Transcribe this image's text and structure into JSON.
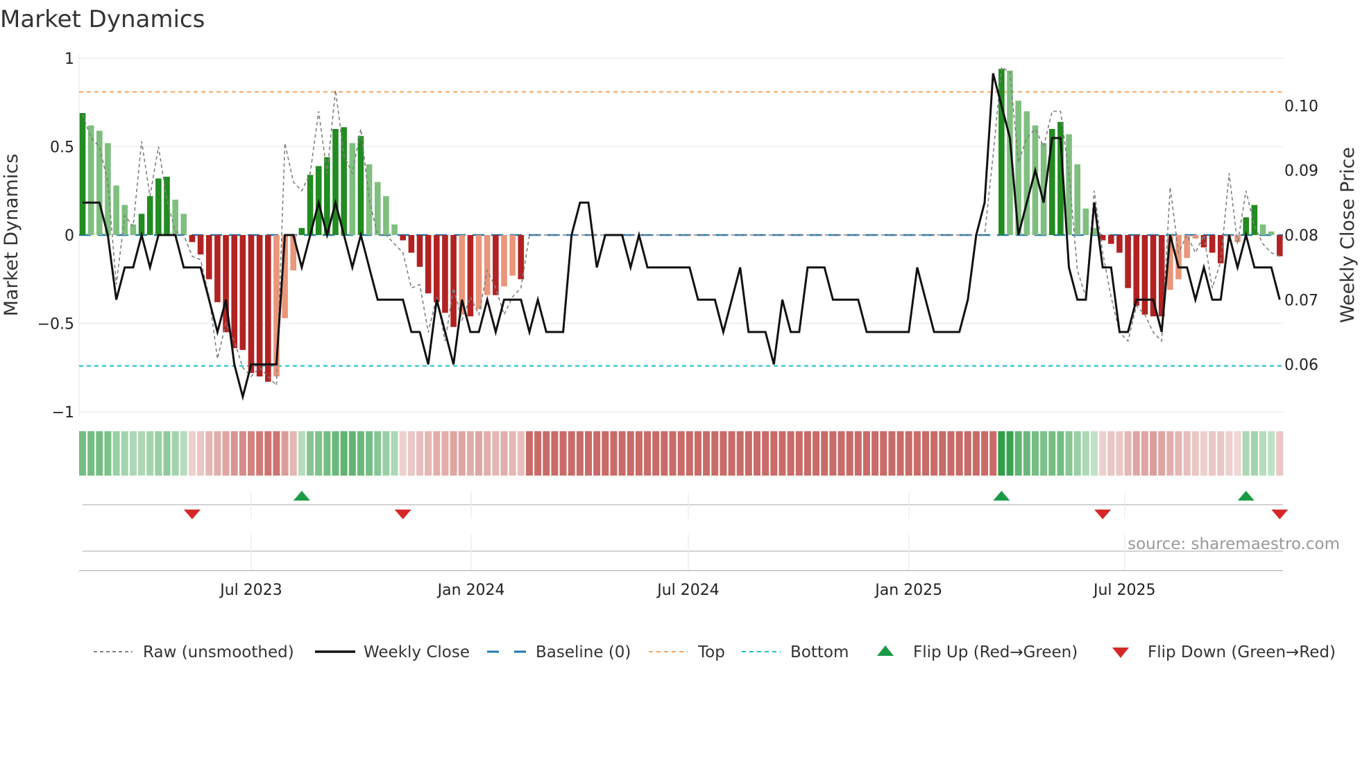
{
  "title": "Market Dynamics",
  "source": "source: sharemaestro.com",
  "colors": {
    "bar_up_strong": "#228B22",
    "bar_up_weak": "#7FBF7F",
    "bar_down_strong": "#B22222",
    "bar_down_weak": "#E9967A",
    "close": "#111111",
    "raw": "#808080",
    "baseline": "#1f77b4",
    "top": "#f4a460",
    "bottom": "#17becf",
    "flip_up": "#1a9a45",
    "flip_down": "#d62728",
    "band_green": "#22963a",
    "band_red": "#b83c37"
  },
  "legend": [
    {
      "key": "raw",
      "label": "Raw (unsmoothed)"
    },
    {
      "key": "close",
      "label": "Weekly Close"
    },
    {
      "key": "baseline",
      "label": "Baseline (0)"
    },
    {
      "key": "top",
      "label": "Top"
    },
    {
      "key": "bottom",
      "label": "Bottom"
    },
    {
      "key": "flip_up",
      "label": "Flip Up (Red→Green)"
    },
    {
      "key": "flip_down",
      "label": "Flip Down (Green→Red)"
    }
  ],
  "chart_data": {
    "type": "bar",
    "title": "Market Dynamics",
    "ylabel": "Market Dynamics",
    "y2label": "Weekly Close Price",
    "xunit": "week",
    "ylim": [
      -1,
      1
    ],
    "y2lim": [
      0.0528,
      0.1077
    ],
    "yticks": [
      {
        "v": 1,
        "label": "1"
      },
      {
        "v": 0.5,
        "label": "0.5"
      },
      {
        "v": 0,
        "label": "0"
      },
      {
        "v": -0.5,
        "label": "−0.5"
      },
      {
        "v": -1,
        "label": "−1"
      }
    ],
    "y2ticks": [
      {
        "v": 0.1,
        "label": "0.10"
      },
      {
        "v": 0.09,
        "label": "0.09"
      },
      {
        "v": 0.08,
        "label": "0.08"
      },
      {
        "v": 0.07,
        "label": "0.07"
      },
      {
        "v": 0.06,
        "label": "0.06"
      }
    ],
    "xticks": [
      {
        "week": 20,
        "label": "Jul 2023"
      },
      {
        "week": 46.1,
        "label": "Jan 2024"
      },
      {
        "week": 71.85,
        "label": "Jul 2024"
      },
      {
        "week": 98,
        "label": "Jan 2025"
      },
      {
        "week": 123.6,
        "label": "Jul 2025"
      }
    ],
    "top_level": 0.81,
    "bottom_level": -0.74,
    "baseline": 0,
    "momentum": [
      0.69,
      0.62,
      0.59,
      0.52,
      0.28,
      0.17,
      0.06,
      0.12,
      0.22,
      0.32,
      0.33,
      0.2,
      0.12,
      -0.04,
      -0.11,
      -0.25,
      -0.38,
      -0.55,
      -0.64,
      -0.65,
      -0.78,
      -0.8,
      -0.83,
      -0.8,
      -0.47,
      -0.2,
      0.04,
      0.34,
      0.39,
      0.44,
      0.6,
      0.61,
      0.52,
      0.56,
      0.4,
      0.3,
      0.22,
      0.06,
      -0.03,
      -0.1,
      -0.18,
      -0.33,
      -0.38,
      -0.44,
      -0.52,
      -0.45,
      -0.46,
      -0.42,
      -0.34,
      -0.34,
      -0.29,
      -0.23,
      -0.25,
      0,
      0,
      0,
      0,
      0,
      0,
      0,
      0,
      0,
      0,
      0,
      0,
      0,
      0,
      0,
      0,
      0,
      0,
      0,
      0,
      0,
      0,
      0,
      0,
      0,
      0,
      0,
      0,
      0,
      0,
      0,
      0,
      0,
      0,
      0,
      0,
      0,
      0,
      0,
      0,
      0,
      0,
      0,
      0,
      0,
      0,
      0,
      0,
      0,
      0,
      0,
      0,
      0,
      0,
      0,
      0,
      0.94,
      0.93,
      0.76,
      0.7,
      0.62,
      0.52,
      0.6,
      0.64,
      0.57,
      0.4,
      0.15,
      0.04,
      -0.03,
      -0.05,
      -0.1,
      -0.3,
      -0.4,
      -0.45,
      -0.46,
      -0.46,
      -0.31,
      -0.25,
      -0.13,
      -0.02,
      -0.07,
      -0.1,
      -0.16,
      -0.01,
      -0.04,
      0.1,
      0.17,
      0.06,
      0.02,
      -0.12
    ],
    "momentum_shade": "DLLLLLLDDDDLLDDDDDDDDDDLLLDDDDDDLDLLLLDDDDDDDLDLLDLLDDLLLLLDDLLLLDDDDDDDDLLLLDDDLLDDLLD",
    "raw": [
      0.68,
      0.55,
      0.5,
      0.3,
      -0.28,
      0.11,
      0.05,
      0.53,
      0.22,
      0.5,
      0.2,
      0.02,
      0.0,
      -0.12,
      -0.14,
      -0.35,
      -0.7,
      -0.5,
      -0.6,
      -0.75,
      -0.8,
      -0.75,
      -0.8,
      -0.85,
      0.52,
      0.3,
      0.25,
      0.35,
      0.7,
      0.35,
      0.82,
      0.45,
      0.35,
      0.6,
      0.2,
      0.0,
      0.0,
      -0.05,
      -0.1,
      -0.3,
      -0.28,
      -0.55,
      -0.35,
      -0.6,
      -0.3,
      -0.48,
      -0.35,
      -0.45,
      -0.2,
      -0.3,
      -0.45,
      -0.35,
      -0.3,
      0,
      0,
      0,
      0,
      0,
      0,
      0,
      0,
      0,
      0,
      0,
      0,
      0,
      0,
      0,
      0,
      0,
      0,
      0,
      0,
      0,
      0,
      0,
      0,
      0,
      0,
      0,
      0,
      0,
      0,
      0,
      0,
      0,
      0,
      0,
      0,
      0,
      0,
      0,
      0,
      0,
      0,
      0,
      0,
      0,
      0,
      0,
      0,
      0,
      0,
      0,
      0,
      0,
      0,
      0,
      0.45,
      0.95,
      0.92,
      0.41,
      0.55,
      0.6,
      0.5,
      0.7,
      0.7,
      0.35,
      -0.2,
      -0.35,
      0.25,
      -0.1,
      -0.35,
      -0.55,
      -0.6,
      -0.4,
      -0.45,
      -0.55,
      -0.6,
      0.27,
      -0.1,
      0,
      -0.1,
      0,
      -0.3,
      -0.15,
      0.35,
      -0.05,
      0.25,
      0.05,
      -0.05,
      -0.1,
      -0.12
    ],
    "close": [
      0.085,
      0.085,
      0.085,
      0.08,
      0.07,
      0.075,
      0.075,
      0.08,
      0.075,
      0.08,
      0.08,
      0.08,
      0.075,
      0.075,
      0.075,
      0.07,
      0.065,
      0.07,
      0.06,
      0.055,
      0.06,
      0.06,
      0.06,
      0.06,
      0.08,
      0.08,
      0.075,
      0.08,
      0.085,
      0.08,
      0.085,
      0.08,
      0.075,
      0.08,
      0.075,
      0.07,
      0.07,
      0.07,
      0.07,
      0.065,
      0.065,
      0.06,
      0.07,
      0.065,
      0.06,
      0.07,
      0.065,
      0.065,
      0.07,
      0.065,
      0.07,
      0.07,
      0.07,
      0.065,
      0.07,
      0.065,
      0.065,
      0.065,
      0.08,
      0.085,
      0.085,
      0.075,
      0.08,
      0.08,
      0.08,
      0.075,
      0.08,
      0.075,
      0.075,
      0.075,
      0.075,
      0.075,
      0.075,
      0.07,
      0.07,
      0.07,
      0.065,
      0.07,
      0.075,
      0.065,
      0.065,
      0.065,
      0.06,
      0.07,
      0.065,
      0.065,
      0.075,
      0.075,
      0.075,
      0.07,
      0.07,
      0.07,
      0.07,
      0.065,
      0.065,
      0.065,
      0.065,
      0.065,
      0.065,
      0.075,
      0.07,
      0.065,
      0.065,
      0.065,
      0.065,
      0.07,
      0.08,
      0.085,
      0.105,
      0.1,
      0.095,
      0.08,
      0.085,
      0.09,
      0.085,
      0.095,
      0.095,
      0.075,
      0.07,
      0.07,
      0.085,
      0.075,
      0.075,
      0.065,
      0.065,
      0.07,
      0.07,
      0.07,
      0.065,
      0.08,
      0.075,
      0.075,
      0.07,
      0.075,
      0.07,
      0.07,
      0.08,
      0.075,
      0.08,
      0.075,
      0.075,
      0.075,
      0.07
    ],
    "regime": [
      0.6,
      0.6,
      0.6,
      0.55,
      0.4,
      0.35,
      0.3,
      0.3,
      0.35,
      0.4,
      0.45,
      0.35,
      0.25,
      -0.15,
      -0.2,
      -0.3,
      -0.35,
      -0.4,
      -0.5,
      -0.55,
      -0.6,
      -0.65,
      -0.7,
      -0.7,
      -0.45,
      -0.3,
      0.25,
      0.5,
      0.55,
      0.6,
      0.65,
      0.7,
      0.7,
      0.65,
      0.6,
      0.5,
      0.4,
      0.3,
      -0.15,
      -0.2,
      -0.25,
      -0.3,
      -0.35,
      -0.35,
      -0.4,
      -0.4,
      -0.35,
      -0.4,
      -0.35,
      -0.3,
      -0.35,
      -0.3,
      -0.25,
      -0.75,
      -0.75,
      -0.75,
      -0.75,
      -0.75,
      -0.75,
      -0.75,
      -0.75,
      -0.75,
      -0.75,
      -0.75,
      -0.75,
      -0.75,
      -0.75,
      -0.75,
      -0.75,
      -0.75,
      -0.75,
      -0.75,
      -0.75,
      -0.75,
      -0.75,
      -0.75,
      -0.75,
      -0.75,
      -0.75,
      -0.75,
      -0.75,
      -0.75,
      -0.75,
      -0.75,
      -0.75,
      -0.75,
      -0.75,
      -0.75,
      -0.75,
      -0.75,
      -0.75,
      -0.75,
      -0.75,
      -0.75,
      -0.75,
      -0.75,
      -0.75,
      -0.75,
      -0.75,
      -0.75,
      -0.75,
      -0.75,
      -0.75,
      -0.75,
      -0.75,
      -0.75,
      -0.75,
      -0.75,
      -0.75,
      0.95,
      0.9,
      0.7,
      0.65,
      0.6,
      0.55,
      0.6,
      0.6,
      0.5,
      0.4,
      0.3,
      0.2,
      -0.15,
      -0.2,
      -0.2,
      -0.3,
      -0.4,
      -0.4,
      -0.45,
      -0.4,
      -0.35,
      -0.3,
      -0.25,
      -0.2,
      -0.15,
      -0.2,
      -0.2,
      -0.15,
      -0.1,
      0.3,
      0.35,
      0.25,
      0.2,
      -0.2
    ],
    "flips": [
      {
        "type": "down",
        "week": 13
      },
      {
        "type": "up",
        "week": 26
      },
      {
        "type": "down",
        "week": 38
      },
      {
        "type": "up",
        "week": 109
      },
      {
        "type": "down",
        "week": 121
      },
      {
        "type": "up",
        "week": 138
      },
      {
        "type": "down",
        "week": 142
      }
    ]
  }
}
